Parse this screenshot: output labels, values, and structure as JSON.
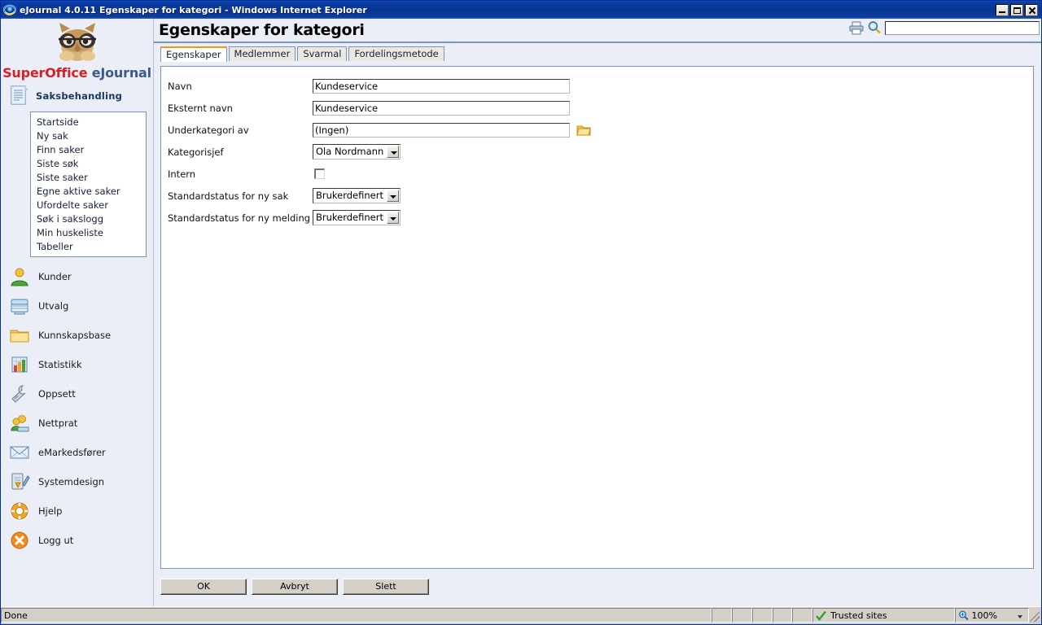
{
  "window": {
    "title": "eJournal 4.0.11 Egenskaper for kategori - Windows Internet Explorer",
    "icon": "internet-explorer-icon",
    "controls": {
      "minimize": "Minimize",
      "maximize": "Maximize",
      "close": "Close"
    },
    "titlebar_color": "#08358f"
  },
  "sidebar": {
    "logo": {
      "icon": "owl-logo-icon",
      "brand_part1": "SuperOffice",
      "brand_part2": "eJournal",
      "brand_color1": "#d81f26",
      "brand_color2": "#3c5a87"
    },
    "group": {
      "label": "Saksbehandling",
      "icon": "document-icon"
    },
    "submenu": [
      {
        "label": "Startside"
      },
      {
        "label": "Ny sak"
      },
      {
        "label": "Finn saker"
      },
      {
        "label": "Siste søk"
      },
      {
        "label": "Siste saker"
      },
      {
        "label": "Egne aktive saker"
      },
      {
        "label": "Ufordelte saker"
      },
      {
        "label": "Søk i sakslogg"
      },
      {
        "label": "Min huskeliste"
      },
      {
        "label": "Tabeller"
      }
    ],
    "items": [
      {
        "label": "Kunder",
        "icon": "person-icon"
      },
      {
        "label": "Utvalg",
        "icon": "archive-basket-icon"
      },
      {
        "label": "Kunnskapsbase",
        "icon": "folder-icon"
      },
      {
        "label": "Statistikk",
        "icon": "bar-chart-icon"
      },
      {
        "label": "Oppsett",
        "icon": "wrench-icon"
      },
      {
        "label": "Nettprat",
        "icon": "people-chat-icon"
      },
      {
        "label": "eMarkedsfører",
        "icon": "envelope-icon"
      },
      {
        "label": "Systemdesign",
        "icon": "pencil-clipboard-icon"
      },
      {
        "label": "Hjelp",
        "icon": "life-ring-icon"
      },
      {
        "label": "Logg ut",
        "icon": "logout-circle-x-icon"
      }
    ]
  },
  "header": {
    "title": "Egenskaper for kategori",
    "print_icon": "printer-icon",
    "search_icon": "magnifier-key-icon",
    "search_value": "",
    "search_placeholder": ""
  },
  "tabs": [
    {
      "label": "Egenskaper",
      "active": true
    },
    {
      "label": "Medlemmer",
      "active": false
    },
    {
      "label": "Svarmal",
      "active": false
    },
    {
      "label": "Fordelingsmetode",
      "active": false
    }
  ],
  "form": {
    "navn": {
      "label": "Navn",
      "value": "Kundeservice"
    },
    "eksternt_navn": {
      "label": "Eksternt navn",
      "value": "Kundeservice"
    },
    "underkategori": {
      "label": "Underkategori av",
      "value": "(Ingen)",
      "browse_icon": "open-folder-icon"
    },
    "kategorisjef": {
      "label": "Kategorisjef",
      "value": "Ola Nordmann"
    },
    "intern": {
      "label": "Intern",
      "checked": false
    },
    "status_sak": {
      "label": "Standardstatus for ny sak",
      "value": "Brukerdefinert"
    },
    "status_melding": {
      "label": "Standardstatus for ny melding",
      "value": "Brukerdefinert"
    }
  },
  "buttons": {
    "ok": "OK",
    "cancel": "Avbryt",
    "delete": "Slett"
  },
  "statusbar": {
    "status": "Done",
    "zone": "Trusted sites",
    "zone_icon": "green-check-icon",
    "zoom": "100%",
    "zoom_icon": "zoom-magnifier-icon"
  }
}
